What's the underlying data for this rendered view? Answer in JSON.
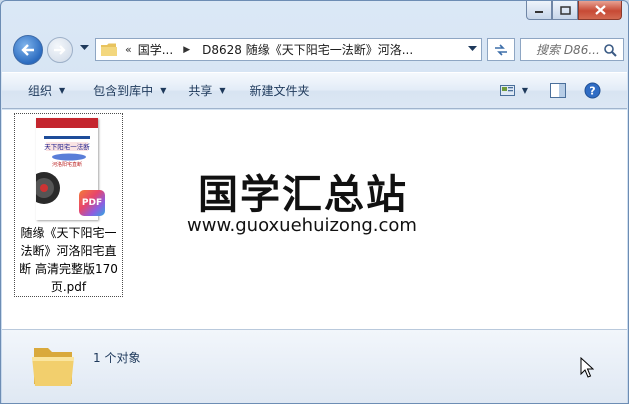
{
  "address": {
    "overflow_glyph": "«",
    "segments": [
      "国学...",
      "D8628 随缘《天下阳宅一法断》河洛..."
    ]
  },
  "search": {
    "placeholder": "搜索 D86..."
  },
  "toolbar": {
    "organize": "组织",
    "include_in_library": "包含到库中",
    "share": "共享",
    "new_folder": "新建文件夹"
  },
  "file": {
    "name": "随缘《天下阳宅一法断》河洛阳宅直断 高清完整版170页.pdf",
    "badge": "PDF",
    "cover_lines": [
      "天下阳宅一法断",
      "河洛阳宅直断"
    ]
  },
  "watermark": {
    "title": "国学汇总站",
    "url": "www.guoxuehuizong.com"
  },
  "status": {
    "object_count": "1 个对象"
  },
  "colors": {
    "accent": "#1e395b",
    "close_button": "#c74a35",
    "toolbar_bg": "#e3ecf7"
  }
}
